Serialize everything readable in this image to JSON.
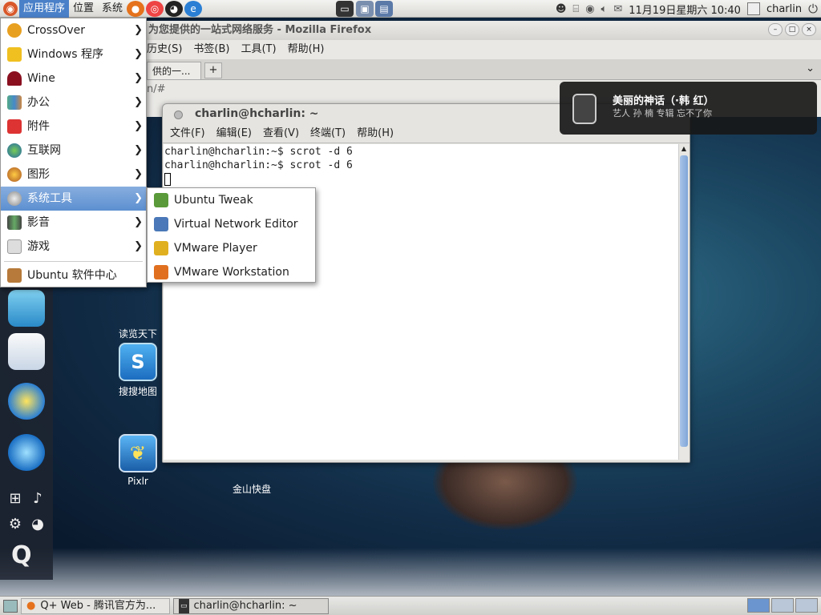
{
  "topbar": {
    "menus": [
      "应用程序",
      "位置",
      "系统"
    ],
    "datetime": "11月19日星期六 10:40",
    "user": "charlin"
  },
  "firefox": {
    "title": "为您提供的一站式网络服务 - Mozilla Firefox",
    "menus": [
      "历史(S)",
      "书签(B)",
      "工具(T)",
      "帮助(H)"
    ],
    "tab": "供的一...",
    "url": "n/#"
  },
  "terminal": {
    "title": "charlin@hcharlin: ~",
    "menus": [
      "文件(F)",
      "编辑(E)",
      "查看(V)",
      "终端(T)",
      "帮助(H)"
    ],
    "lines": [
      "charlin@hcharlin:~$ scrot -d 6",
      "charlin@hcharlin:~$ scrot -d 6"
    ]
  },
  "app_menu": {
    "items": [
      "CrossOver",
      "Windows 程序",
      "Wine",
      "办公",
      "附件",
      "互联网",
      "图形",
      "系统工具",
      "影音",
      "游戏"
    ],
    "bottom": "Ubuntu 软件中心",
    "highlighted": "系统工具"
  },
  "submenu": {
    "items": [
      "Ubuntu Tweak",
      "Virtual Network Editor",
      "VMware Player",
      "VMware Workstation"
    ]
  },
  "notification": {
    "title": "美丽的神话（·韩  红）",
    "subtitle": "艺人 孙  楠 专辑 忘不了你"
  },
  "desktop_icons": [
    "读览天下",
    "搜搜地图",
    "Pixlr",
    "金山快盘"
  ],
  "taskbar": {
    "tasks": [
      "Q+ Web - 腾讯官方为...",
      "charlin@hcharlin: ~"
    ]
  }
}
